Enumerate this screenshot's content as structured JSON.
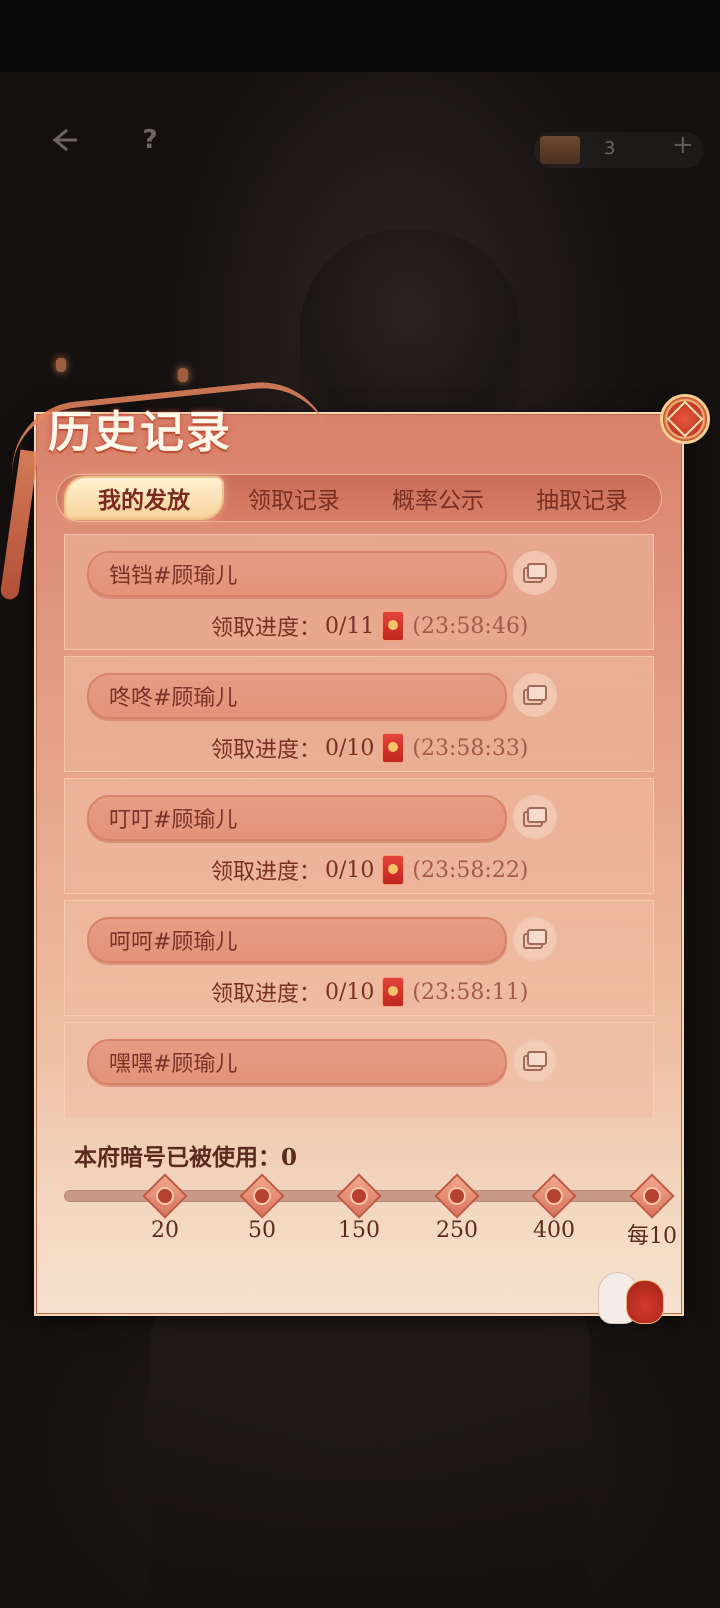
{
  "topbar": {
    "back_icon": "back-arrow-icon",
    "help_label": "?",
    "currency_icon": "book-stack-icon",
    "currency_count": "3",
    "add_label": "+"
  },
  "panel": {
    "title": "历史记录",
    "tabs": [
      {
        "label": "我的发放",
        "active": true
      },
      {
        "label": "领取记录",
        "active": false
      },
      {
        "label": "概率公示",
        "active": false
      },
      {
        "label": "抽取记录",
        "active": false
      }
    ],
    "records": [
      {
        "name": "铛铛#顾瑜儿",
        "progress_label": "领取进度：",
        "progress": "0/11",
        "time": "(23:58:46)"
      },
      {
        "name": "咚咚#顾瑜儿",
        "progress_label": "领取进度：",
        "progress": "0/10",
        "time": "(23:58:33)"
      },
      {
        "name": "叮叮#顾瑜儿",
        "progress_label": "领取进度：",
        "progress": "0/10",
        "time": "(23:58:22)"
      },
      {
        "name": "呵呵#顾瑜儿",
        "progress_label": "领取进度：",
        "progress": "0/10",
        "time": "(23:58:11)"
      },
      {
        "name": "嘿嘿#顾瑜儿",
        "progress_label": "",
        "progress": "",
        "time": ""
      }
    ],
    "usage_label": "本府暗号已被使用：0",
    "milestones": [
      "20",
      "50",
      "150",
      "250",
      "400",
      "每10"
    ],
    "colors": {
      "accent_red": "#c0271f",
      "panel_top": "#d8806a",
      "panel_bottom": "#f6e2cf",
      "text_dark_red": "#7a2f25"
    }
  }
}
